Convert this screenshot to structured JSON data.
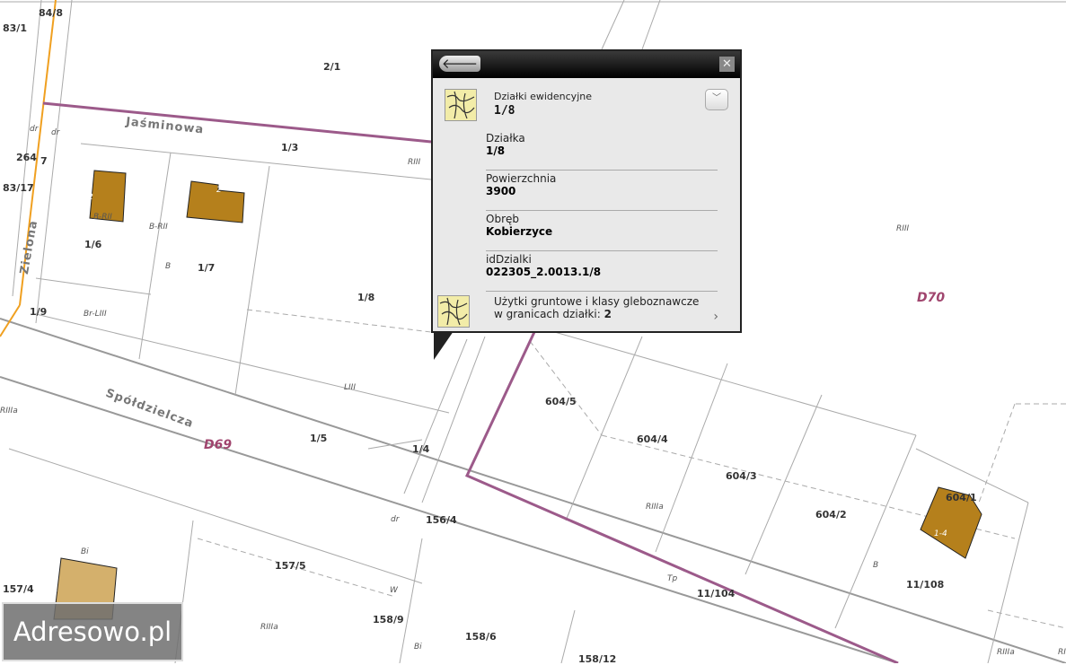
{
  "map": {
    "parcels": [
      "84/8",
      "83/1",
      "2/1",
      "264",
      "7",
      "83/17",
      "1/3",
      "1/6",
      "1/7",
      "1/8",
      "1/9",
      "1/5",
      "1/4",
      "604/5",
      "604/4",
      "604/3",
      "604/2",
      "604/1",
      "156/4",
      "157/5",
      "157/4",
      "158/9",
      "158/6",
      "158/12",
      "11/104",
      "11/108"
    ],
    "symbols": [
      "dr",
      "dr",
      "RIII",
      "B-RII",
      "B-RII",
      "B",
      "Br-LIII",
      "LIII",
      "RIIIa",
      "RIII",
      "RIIIa",
      "dr",
      "RIIIa",
      "Bi",
      "W",
      "RIIIa",
      "Bi",
      "Tp",
      "B",
      "RIIIa",
      "2",
      "2",
      "1",
      "1-4"
    ],
    "streets": [
      "Jaśminowa",
      "Zielona",
      "Spółdzielcza"
    ],
    "districts": [
      "D69",
      "D70"
    ],
    "colors": {
      "building": "#b5801c",
      "building_light": "#d4b06c",
      "boundary": "#9c5a8a",
      "road": "#f0a020"
    }
  },
  "popup": {
    "layer_title": "Działki ewidencyjne",
    "layer_value": "1/8",
    "fields": [
      {
        "label": "Działka",
        "value": "1/8"
      },
      {
        "label": "Powierzchnia",
        "value": "3900"
      },
      {
        "label": "Obręb",
        "value": "Kobierzyce"
      },
      {
        "label": "idDzialki",
        "value": "022305_2.0013.1/8"
      }
    ],
    "related_text": "Użytki gruntowe i klasy gleboznawcze w granicach działki:",
    "related_count": "2",
    "back_icon": "arrow-left-icon",
    "close_icon": "close-icon"
  },
  "logo": "Adresowo.pl"
}
